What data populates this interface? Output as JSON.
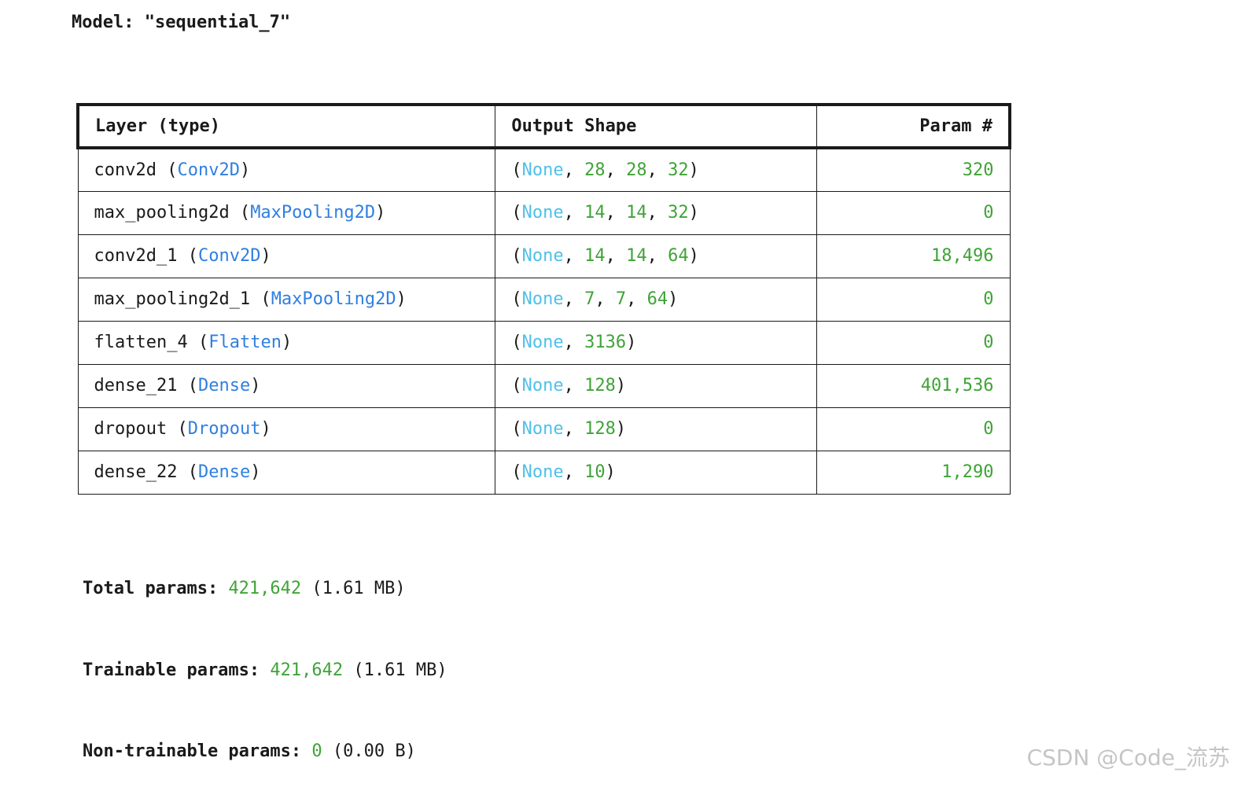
{
  "model": {
    "label": "Model:",
    "name": "\"sequential_7\""
  },
  "table": {
    "headers": {
      "layer": "Layer (type)",
      "shape": "Output Shape",
      "param": "Param #"
    },
    "rows": [
      {
        "name": "conv2d",
        "type": "Conv2D",
        "shape_none": "None",
        "shape_rest": [
          "28",
          "28",
          "32"
        ],
        "params": "320"
      },
      {
        "name": "max_pooling2d",
        "type": "MaxPooling2D",
        "shape_none": "None",
        "shape_rest": [
          "14",
          "14",
          "32"
        ],
        "params": "0"
      },
      {
        "name": "conv2d_1",
        "type": "Conv2D",
        "shape_none": "None",
        "shape_rest": [
          "14",
          "14",
          "64"
        ],
        "params": "18,496"
      },
      {
        "name": "max_pooling2d_1",
        "type": "MaxPooling2D",
        "shape_none": "None",
        "shape_rest": [
          "7",
          "7",
          "64"
        ],
        "params": "0"
      },
      {
        "name": "flatten_4",
        "type": "Flatten",
        "shape_none": "None",
        "shape_rest": [
          "3136"
        ],
        "params": "0"
      },
      {
        "name": "dense_21",
        "type": "Dense",
        "shape_none": "None",
        "shape_rest": [
          "128"
        ],
        "params": "401,536"
      },
      {
        "name": "dropout",
        "type": "Dropout",
        "shape_none": "None",
        "shape_rest": [
          "128"
        ],
        "params": "0"
      },
      {
        "name": "dense_22",
        "type": "Dense",
        "shape_none": "None",
        "shape_rest": [
          "10"
        ],
        "params": "1,290"
      }
    ]
  },
  "totals": {
    "total": {
      "label": "Total params:",
      "value": "421,642",
      "size": "(1.61 MB)"
    },
    "trainable": {
      "label": "Trainable params:",
      "value": "421,642",
      "size": "(1.61 MB)"
    },
    "non_trainable": {
      "label": "Non-trainable params:",
      "value": "0",
      "size": "(0.00 B)"
    }
  },
  "watermark": "CSDN @Code_流苏",
  "colors": {
    "layer_type": "#2f7fe0",
    "none_value": "#4fc0e8",
    "numbers": "#3fa336",
    "text": "#1a1a1a"
  }
}
